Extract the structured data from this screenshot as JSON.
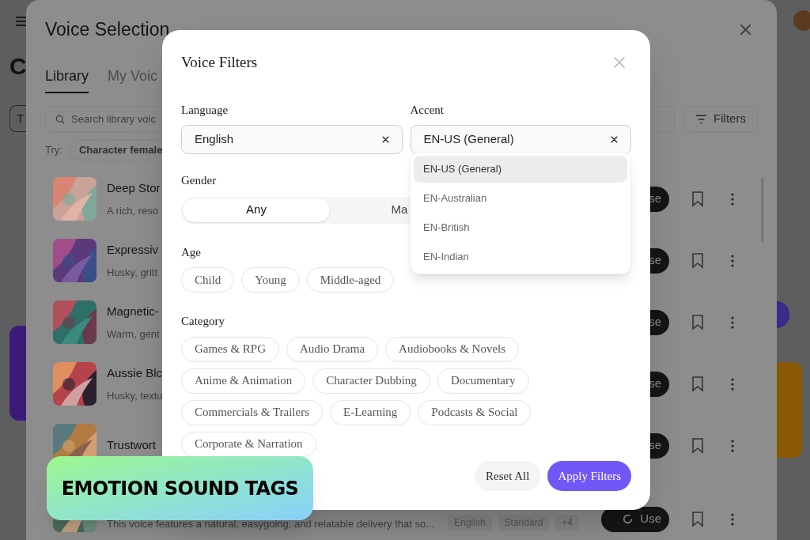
{
  "app": {
    "logo_letter": "C",
    "chip": "T"
  },
  "panel": {
    "title": "Voice Selection",
    "tabs": [
      {
        "label": "Library",
        "selected": true
      },
      {
        "label": "My Voic",
        "selected": false
      }
    ],
    "search": {
      "placeholder": "Search library voic"
    },
    "filters_button": "Filters",
    "try_label": "Try:",
    "suggestions": [
      "Character female"
    ],
    "voices": [
      {
        "name": "Deep Stor",
        "description": "A rich, reso",
        "use": "se"
      },
      {
        "name": "Expressiv",
        "description": "Husky, gritt",
        "use": "se"
      },
      {
        "name": "Magnetic-",
        "description": "Warm, gent",
        "use": "se"
      },
      {
        "name": "Aussie Blc",
        "description": "Husky, textu",
        "use": "se"
      },
      {
        "name": "Trustwort",
        "use": "se"
      },
      {
        "description": "This voice features a natural, easygoing, and relatable delivery that so...",
        "tags": [
          "English",
          "Standard",
          "+4"
        ],
        "use": "Use"
      }
    ]
  },
  "modal": {
    "title": "Voice Filters",
    "language": {
      "label": "Language",
      "value": "English"
    },
    "accent": {
      "label": "Accent",
      "value": "EN-US (General)",
      "options": [
        {
          "label": "EN-US (General)",
          "selected": true
        },
        {
          "label": "EN-Australian",
          "selected": false
        },
        {
          "label": "EN-British",
          "selected": false
        },
        {
          "label": "EN-Indian",
          "selected": false
        }
      ]
    },
    "gender": {
      "label": "Gender",
      "options": [
        {
          "label": "Any",
          "selected": true
        },
        {
          "label": "Ma",
          "selected": false
        }
      ]
    },
    "age": {
      "label": "Age",
      "options": [
        {
          "label": "Child",
          "selected": false
        },
        {
          "label": "Young",
          "selected": false
        },
        {
          "label": "Middle-aged",
          "selected": false
        }
      ]
    },
    "category": {
      "label": "Category",
      "options": [
        {
          "label": "Games & RPG",
          "selected": false
        },
        {
          "label": "Audio Drama",
          "selected": false
        },
        {
          "label": "Audiobooks & Novels",
          "selected": false
        },
        {
          "label": "Anime & Animation",
          "selected": false
        },
        {
          "label": "Character Dubbing",
          "selected": false
        },
        {
          "label": "Documentary",
          "selected": false
        },
        {
          "label": "Commercials & Trailers",
          "selected": false
        },
        {
          "label": "E-Learning",
          "selected": false
        },
        {
          "label": "Podcasts & Social",
          "selected": false
        },
        {
          "label": "Corporate & Narration",
          "selected": false
        }
      ]
    },
    "reset_button": "Reset All",
    "apply_button": "Apply Filters"
  },
  "badge": {
    "text": "EMOTION SOUND TAGS"
  }
}
